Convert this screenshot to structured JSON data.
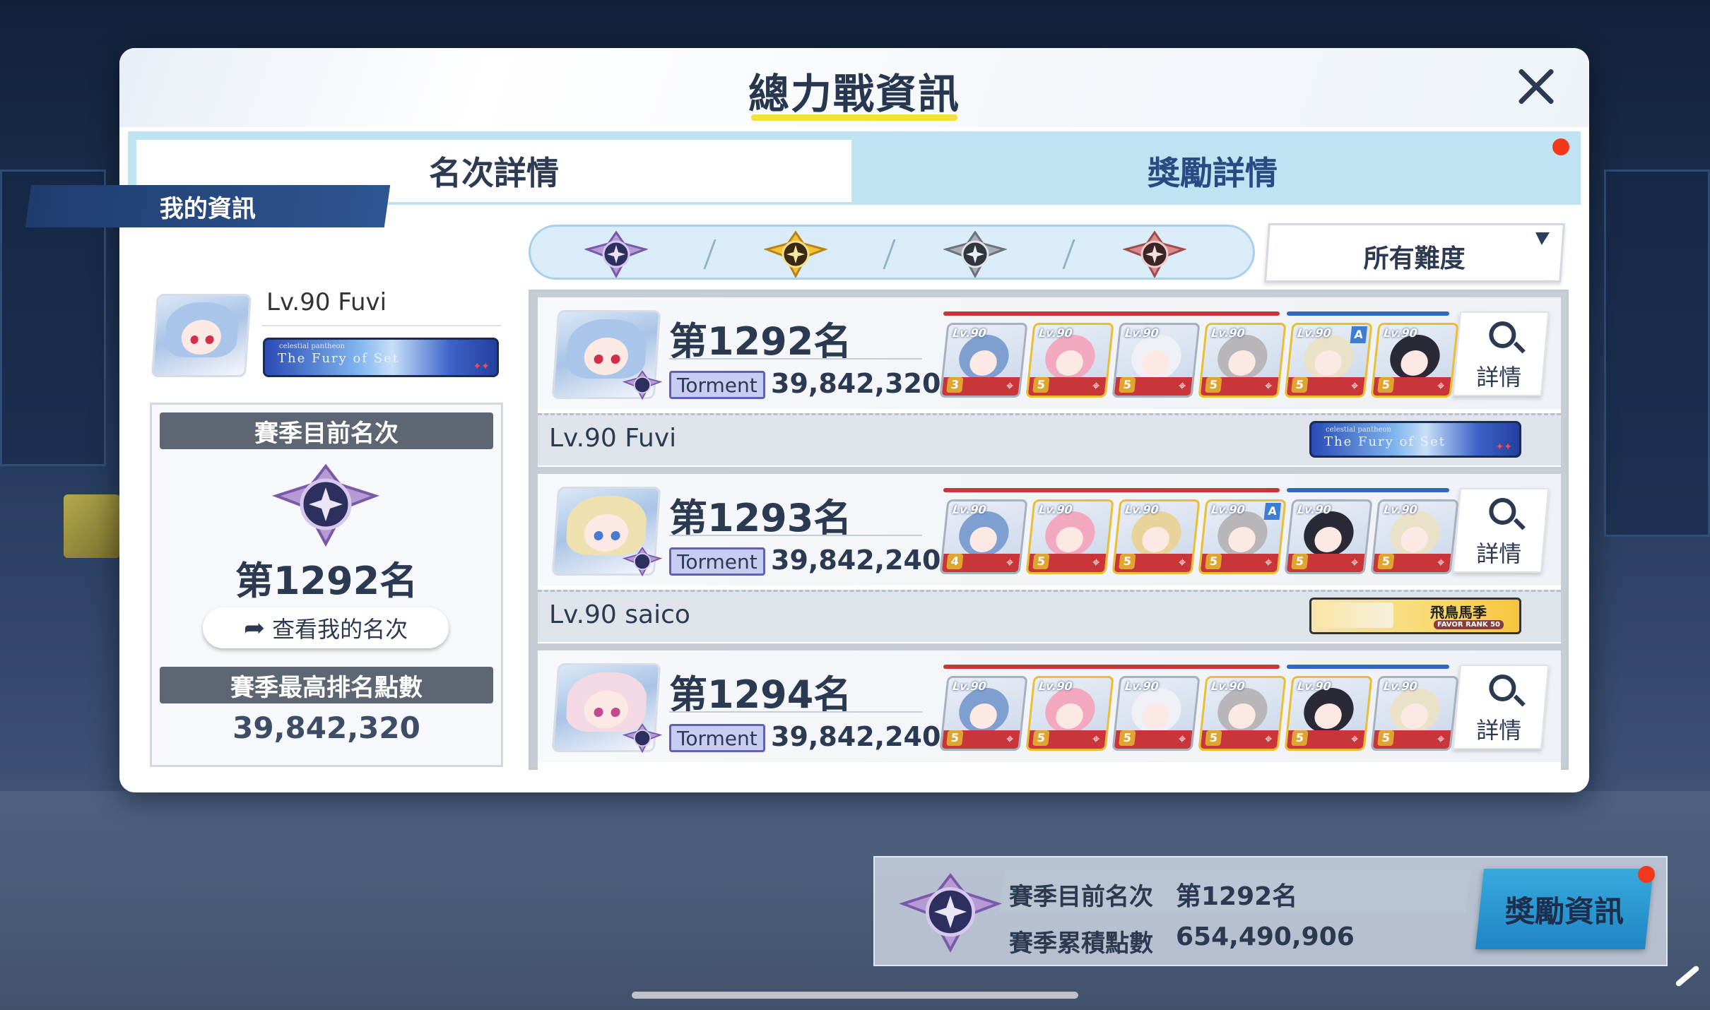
{
  "modal": {
    "title": "總力戰資訊",
    "tabs": [
      {
        "label": "名次詳情",
        "active": true
      },
      {
        "label": "獎勵詳情",
        "active": false,
        "notification": true
      }
    ]
  },
  "my_info": {
    "header": "我的資訊",
    "level_name": "Lv.90 Fuvi",
    "title_badge": {
      "small": "celestial pantheon",
      "main": "The Fury of Set"
    },
    "season_rank_label": "賽季目前名次",
    "season_rank": "第1292名",
    "view_my_rank_button": "查看我的名次",
    "best_score_label": "賽季最高排名點數",
    "best_score": "39,842,320"
  },
  "difficulty_filter": {
    "icons": [
      "torment-purple-emblem-icon",
      "insane-gold-emblem-icon",
      "extreme-gray-emblem-icon",
      "hardcore-red-emblem-icon"
    ],
    "dropdown_label": "所有難度"
  },
  "entries": [
    {
      "rank": "第1292名",
      "difficulty": "Torment",
      "score": "39,842,320",
      "player": "Lv.90  Fuvi",
      "badge_type": "title",
      "badge": {
        "small": "celestial pantheon",
        "main": "The Fury of Set"
      },
      "detail_label": "詳情",
      "characters": [
        {
          "lv": "Lv.90",
          "star": "3",
          "gold": false,
          "hair": "#7f9fd0"
        },
        {
          "lv": "Lv.90",
          "star": "5",
          "gold": true,
          "hair": "#f2a9c0"
        },
        {
          "lv": "Lv.90",
          "star": "5",
          "gold": false,
          "hair": "#eef0f6"
        },
        {
          "lv": "Lv.90",
          "star": "5",
          "gold": true,
          "hair": "#b8b6b8"
        },
        {
          "lv": "Lv.90",
          "star": "5",
          "gold": true,
          "hair": "#e9e1c8",
          "assist": "A"
        },
        {
          "lv": "Lv.90",
          "star": "5",
          "gold": true,
          "hair": "#2a2a36"
        }
      ]
    },
    {
      "rank": "第1293名",
      "difficulty": "Torment",
      "score": "39,842,240",
      "player": "Lv.90  saico",
      "badge_type": "favor",
      "badge": {
        "name": "飛鳥馬季",
        "sub": "FAVOR RANK 50"
      },
      "detail_label": "詳情",
      "characters": [
        {
          "lv": "Lv.90",
          "star": "4",
          "gold": false,
          "hair": "#7f9fd0"
        },
        {
          "lv": "Lv.90",
          "star": "5",
          "gold": true,
          "hair": "#f2a9c0"
        },
        {
          "lv": "Lv.90",
          "star": "5",
          "gold": true,
          "hair": "#e8d39a"
        },
        {
          "lv": "Lv.90",
          "star": "5",
          "gold": true,
          "hair": "#b8b6b8",
          "assist": "A"
        },
        {
          "lv": "Lv.90",
          "star": "5",
          "gold": false,
          "hair": "#2a2a36"
        },
        {
          "lv": "Lv.90",
          "star": "5",
          "gold": false,
          "hair": "#e9e1c8"
        }
      ]
    },
    {
      "rank": "第1294名",
      "difficulty": "Torment",
      "score": "39,842,240",
      "player": "",
      "badge_type": "none",
      "detail_label": "詳情",
      "characters": [
        {
          "lv": "Lv.90",
          "star": "5",
          "gold": false,
          "hair": "#7f9fd0"
        },
        {
          "lv": "Lv.90",
          "star": "5",
          "gold": true,
          "hair": "#f2a9c0"
        },
        {
          "lv": "Lv.90",
          "star": "5",
          "gold": false,
          "hair": "#eef0f6"
        },
        {
          "lv": "Lv.90",
          "star": "5",
          "gold": true,
          "hair": "#b8b6b8"
        },
        {
          "lv": "Lv.90",
          "star": "5",
          "gold": true,
          "hair": "#2a2a36"
        },
        {
          "lv": "Lv.90",
          "star": "5",
          "gold": false,
          "hair": "#e9e1c8"
        }
      ]
    }
  ],
  "summary": {
    "rank_label": "賽季目前名次",
    "rank_value": "第1292名",
    "points_label": "賽季累積點數",
    "points_value": "654,490,906",
    "reward_button": "獎勵資訊"
  },
  "colors": {
    "accent_yellow": "#f2e13a",
    "tab_blue": "#bfe3f3",
    "notification_red": "#f0391a",
    "torment_purple": "#5d62b1"
  }
}
